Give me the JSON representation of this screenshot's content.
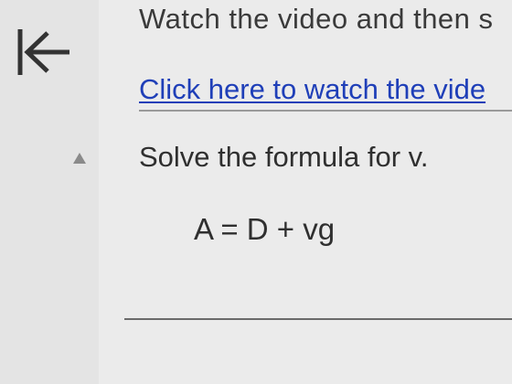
{
  "navigation": {
    "back_icon": "back-to-start-icon",
    "collapse_icon": "caret-left-icon"
  },
  "question": {
    "instruction": "Watch the video and then s",
    "video_link": "Click here to watch the vide",
    "prompt": "Solve the formula for v.",
    "equation": "A = D + vg"
  },
  "colors": {
    "link": "#1f3fb8",
    "text": "#2f2f2f",
    "background": "#ebebeb"
  }
}
